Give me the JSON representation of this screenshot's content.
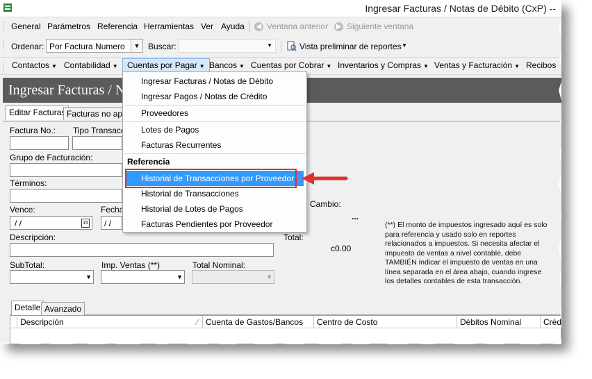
{
  "window": {
    "title": "Ingresar Facturas / Notas de Débito (CxP) --"
  },
  "menu": {
    "items": [
      "General",
      "Parámetros",
      "Referencia",
      "Herramientas",
      "Ver",
      "Ayuda"
    ],
    "prev_window": "Ventana anterior",
    "next_window": "Siguiente ventana"
  },
  "toolbar": {
    "order_label": "Ordenar:",
    "order_value": "Por Factura Numero",
    "search_label": "Buscar:",
    "search_value": "",
    "preview_label": "Vista preliminar de reportes"
  },
  "nav": [
    "Contactos",
    "Contabilidad",
    "Cuentas por Pagar",
    "Bancos",
    "Cuentas por Cobrar",
    "Inventarios y Compras",
    "Ventas y Facturación",
    "Recibos"
  ],
  "form": {
    "header": "Ingresar Facturas / N",
    "tabs": [
      "Editar Facturas",
      "Facturas no aplic"
    ],
    "invoice_no_label": "Factura No.:",
    "trans_type_label": "Tipo Transacci",
    "billing_group_label": "Grupo de Facturación:",
    "terms_label": "Términos:",
    "due_label": "Vence:",
    "due_value": " / /",
    "date_label": "Fecha",
    "date_value": " / /",
    "exchange_label": "Cambio:",
    "exchange_value": "...",
    "description_label": "Descripción:",
    "total_label": "Total:",
    "total_value": "c0.00",
    "subtotal_label": "SubTotal:",
    "tax_label": "Imp. Ventas (**)",
    "nominal_label": "Total Nominal:",
    "note": "(**) El monto de impuestos ingresado aquí es solo para referencia y usado solo en reportes relacionados a impuestos. Si necesita afectar el impuesto de ventas a nivel contable, debe TAMBIÉN indicar el impuesto de ventas en una línea separada en el área abajo, cuando ingrese los detalles contables de esta transacción."
  },
  "detail": {
    "tabs": [
      "Detalle",
      "Avanzado"
    ],
    "columns": [
      "Descripción",
      "Cuenta de Gastos/Bancos",
      "Centro de Costo",
      "Débitos Nominal",
      "Crédi"
    ]
  },
  "dropdown": {
    "items": [
      "Ingresar Facturas / Notas de Débito",
      "Ingresar Pagos / Notas de Crédito",
      "Proveedores",
      "Lotes de Pagos",
      "Facturas Recurrentes"
    ],
    "section": "Referencia",
    "ref_items": [
      "Historial de Transacciones por Proveedor",
      "Historial de Transacciones",
      "Historial de Lotes de Pagos",
      "Facturas Pendientes por Proveedor"
    ]
  },
  "colors": {
    "highlight": "#3399ff",
    "annotation": "#e23030",
    "header_bg": "#5b5b5b"
  }
}
